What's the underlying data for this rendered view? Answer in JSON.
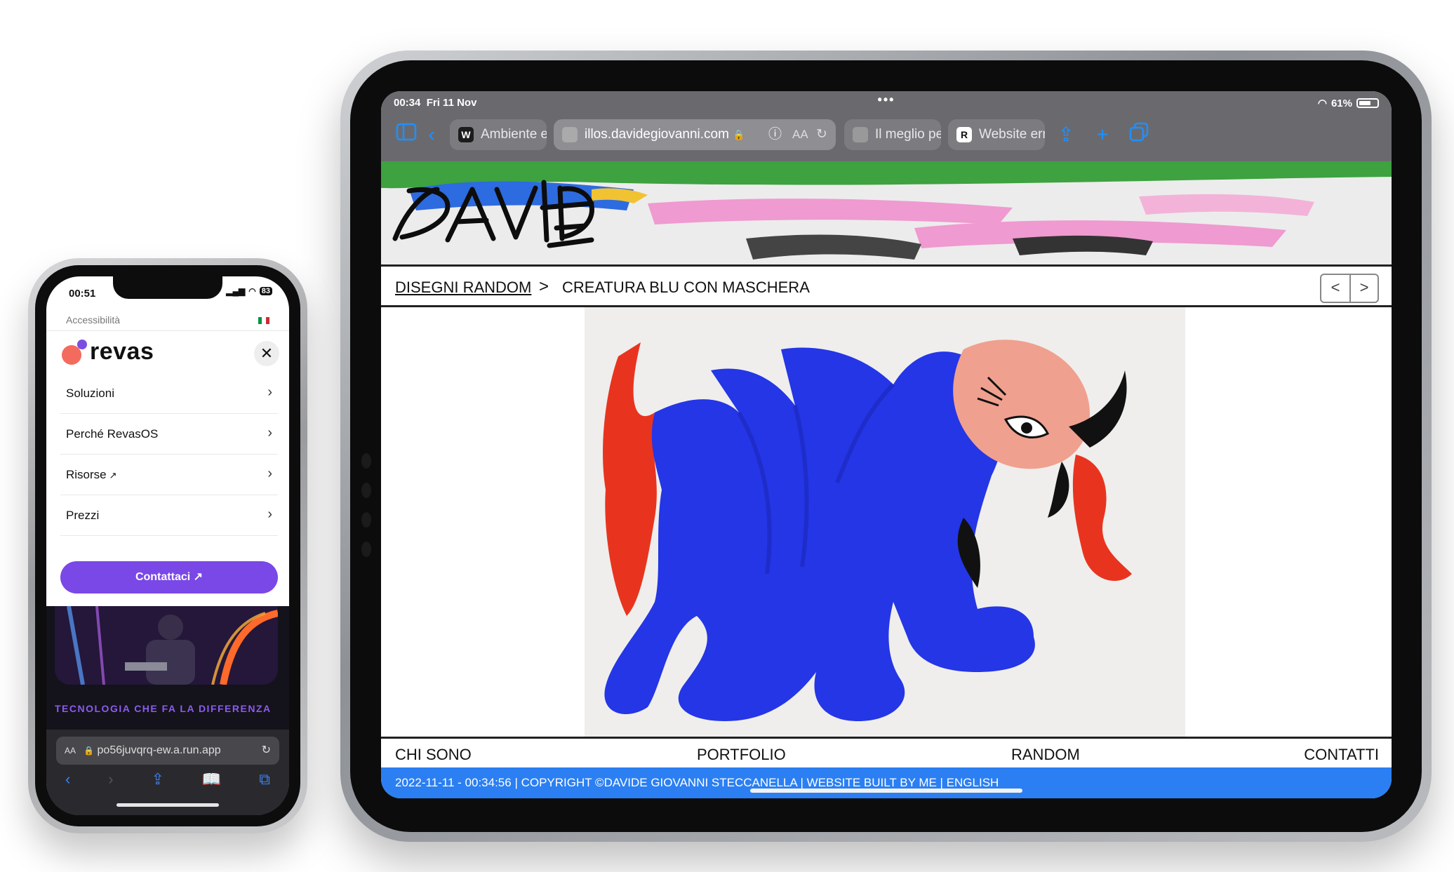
{
  "ipad": {
    "status": {
      "time": "00:34",
      "date": "Fri 11 Nov",
      "battery": "61%",
      "dots": "•••"
    },
    "tabs": [
      {
        "favicon": "W",
        "label": "Ambiente e tecn"
      },
      {
        "favicon": "",
        "label": "illos.davidegiovanni.com",
        "active": true,
        "aa": "AA"
      },
      {
        "favicon": "",
        "label": "Il meglio per il tu"
      },
      {
        "favicon": "R",
        "label": "Website error"
      }
    ],
    "banner_logo": "DAVIDE",
    "breadcrumb": {
      "parent": "DISEGNI RANDOM",
      "separator": ">",
      "current": "CREATURA BLU CON MASCHERA"
    },
    "pager": {
      "prev": "<",
      "next": ">"
    },
    "footer_nav": [
      "CHI SONO",
      "PORTFOLIO",
      "RANDOM",
      "CONTATTI"
    ],
    "copyright": "2022-11-11 - 00:34:56 | COPYRIGHT ©DAVIDE GIOVANNI STECCANELLA | WEBSITE BUILT BY ME |  ENGLISH",
    "colors": {
      "accent": "#2b7ff2",
      "toolbar": "#6a6a6e",
      "art_blue": "#2436e6",
      "art_red": "#e8341f",
      "art_pink": "#f0a08e"
    }
  },
  "iphone": {
    "status": {
      "time": "00:51",
      "battery": "83"
    },
    "accessibility": "Accessibilità",
    "logo": "revas",
    "menu": [
      {
        "label": "Soluzioni",
        "external": false
      },
      {
        "label": "Perché RevasOS",
        "external": false
      },
      {
        "label": "Risorse",
        "external": true
      },
      {
        "label": "Prezzi",
        "external": false
      }
    ],
    "cta": "Contattaci",
    "tagline": "TECNOLOGIA CHE FA LA DIFFERENZA",
    "url": "po56juvqrq-ew.a.run.app",
    "aa": "AA",
    "colors": {
      "brand_purple": "#7a48e6",
      "brand_coral": "#f36b5f"
    }
  }
}
